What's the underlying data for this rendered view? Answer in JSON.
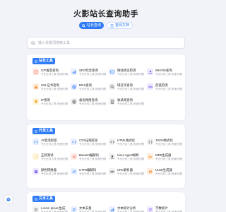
{
  "header": {
    "title": "火影站长查询助手",
    "pill_1": "站长查询",
    "pill_2": "查阅文档"
  },
  "search": {
    "placeholder": "输入关键词搜索工具"
  },
  "categories": [
    {
      "label": "站长工具",
      "tools": [
        {
          "name": "ICP备案查询",
          "desc": "专业在线工具,快速处理数据",
          "icon": "shield-icon",
          "color": "#ffe9e6",
          "fg": "#f0623f"
        },
        {
          "name": "SEO综合查询",
          "desc": "专业在线工具,快速处理数据",
          "icon": "chart-icon",
          "color": "#e8f0ff",
          "fg": "#2f7cf6"
        },
        {
          "name": "网站状态检测",
          "desc": "专业在线工具,快速处理数据",
          "icon": "monitor-icon",
          "color": "#e8f0ff",
          "fg": "#2f7cf6"
        },
        {
          "name": "WHOIS查询",
          "desc": "专业在线工具,快速处理数据",
          "icon": "user-icon",
          "color": "#efe8ff",
          "fg": "#7b5cf0"
        },
        {
          "name": "SSL证书查询",
          "desc": "专业在线工具,快速处理数据",
          "icon": "lock-icon",
          "color": "#ffeede",
          "fg": "#ee8a2b"
        },
        {
          "name": "DNS查询",
          "desc": "专业在线工具,快速处理数据",
          "icon": "globe-icon",
          "color": "#e8f0ff",
          "fg": "#2f7cf6"
        },
        {
          "name": "域名评查询",
          "desc": "专业在线工具,快速处理数据",
          "icon": "search-icon",
          "color": "#f1f1f1",
          "fg": "#555"
        },
        {
          "name": "反链检测",
          "desc": "专业在线工具,快速处理数据",
          "icon": "link-icon",
          "color": "#efe8ff",
          "fg": "#7b5cf0"
        },
        {
          "name": "IP查询",
          "desc": "专业在线工具,快速处理数据",
          "icon": "pin-icon",
          "color": "#fff3d9",
          "fg": "#e8a215"
        },
        {
          "name": "备份网络查询",
          "desc": "专业在线工具,快速处理数据",
          "icon": "globe-icon",
          "color": "#f1f1f1",
          "fg": "#555"
        },
        {
          "name": "收录网查询",
          "desc": "专业在线工具,快速处理数据",
          "icon": "doc-icon",
          "color": "#f1f1f1",
          "fg": "#555"
        }
      ]
    },
    {
      "label": "开发工具",
      "tools": [
        {
          "name": "JS混淆加密",
          "desc": "专业在线工具,快速处理数据",
          "icon": "code-icon",
          "color": "#e8f0ff",
          "fg": "#2f7cf6"
        },
        {
          "name": "CSS压缩美化",
          "desc": "专业在线工具,快速处理数据",
          "icon": "code-icon",
          "color": "#e8f0ff",
          "fg": "#2f7cf6"
        },
        {
          "name": "HTML格式化",
          "desc": "专业在线工具,快速处理数据",
          "icon": "code-icon",
          "color": "#f1f1f1",
          "fg": "#555"
        },
        {
          "name": "JSON格式化",
          "desc": "专业在线工具,快速处理数据",
          "icon": "braces-icon",
          "color": "#f1f1f1",
          "fg": "#555"
        },
        {
          "name": "正则测试",
          "desc": "专业在线工具,快速处理数据",
          "icon": "regex-icon",
          "color": "#fff3d9",
          "fg": "#e8a215"
        },
        {
          "name": "Base64编解码",
          "desc": "专业在线工具,快速处理数据",
          "icon": "swap-icon",
          "color": "#ffe9e6",
          "fg": "#f0623f"
        },
        {
          "name": "User-Agent解析",
          "desc": "专业在线工具,快速处理数据",
          "icon": "user-icon",
          "color": "#f1f1f1",
          "fg": "#555"
        },
        {
          "name": "MD5生成器",
          "desc": "专业在线工具,快速处理数据",
          "icon": "key-icon",
          "color": "#ffeede",
          "fg": "#ee8a2b"
        },
        {
          "name": "颜色转换器",
          "desc": "专业在线工具,快速处理数据",
          "icon": "palette-icon",
          "color": "#efe8ff",
          "fg": "#7b5cf0"
        },
        {
          "name": "UTF8编解码",
          "desc": "专业在线工具,快速处理数据",
          "icon": "swap-icon",
          "color": "#e8f0ff",
          "fg": "#2f7cf6"
        },
        {
          "name": "URL解析器",
          "desc": "专业在线工具,快速处理数据",
          "icon": "link-icon",
          "color": "#f1f1f1",
          "fg": "#555"
        },
        {
          "name": "UUID生成器",
          "desc": "专业在线工具,快速处理数据",
          "icon": "hash-icon",
          "color": "#ffeede",
          "fg": "#ee8a2b"
        }
      ]
    },
    {
      "label": "文本工具",
      "tools": [
        {
          "name": "Lorem Ipsum生成",
          "desc": "专业在线工具,快速处理数据",
          "icon": "text-icon",
          "color": "#f1f1f1",
          "fg": "#555"
        },
        {
          "name": "文本去重",
          "desc": "专业在线工具,快速处理数据",
          "icon": "text-icon",
          "color": "#e8f0ff",
          "fg": "#2f7cf6"
        },
        {
          "name": "文本统计分析",
          "desc": "专业在线工具,快速处理数据",
          "icon": "chart-icon",
          "color": "#e8f0ff",
          "fg": "#2f7cf6"
        },
        {
          "name": "字数统计",
          "desc": "专业在线工具,快速处理数据",
          "icon": "text-icon",
          "color": "#efe8ff",
          "fg": "#7b5cf0"
        }
      ]
    }
  ],
  "accent": "#2f7cf6"
}
